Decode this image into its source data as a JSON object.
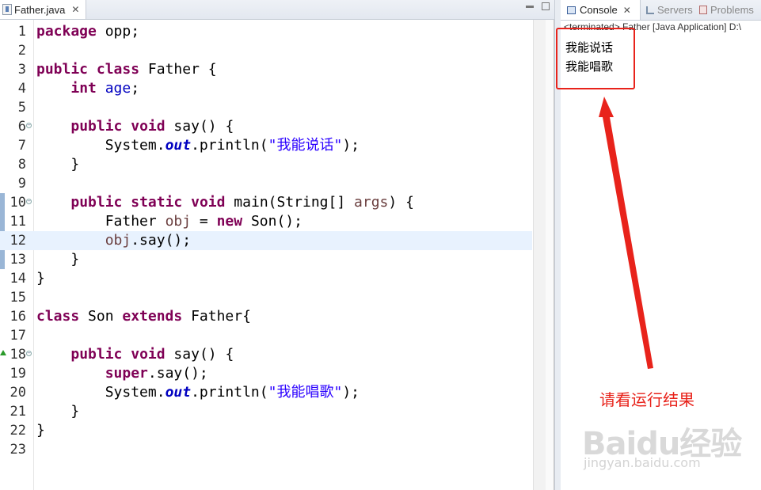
{
  "editor": {
    "tab_title": "Father.java",
    "tab_close": "✕",
    "code_lines": [
      {
        "n": "1",
        "tokens": [
          {
            "c": "kw",
            "t": "package"
          },
          {
            "c": "",
            "t": " opp;"
          }
        ]
      },
      {
        "n": "2",
        "tokens": []
      },
      {
        "n": "3",
        "tokens": [
          {
            "c": "kw",
            "t": "public"
          },
          {
            "c": "",
            "t": " "
          },
          {
            "c": "kw",
            "t": "class"
          },
          {
            "c": "",
            "t": " Father {"
          }
        ]
      },
      {
        "n": "4",
        "tokens": [
          {
            "c": "",
            "t": "    "
          },
          {
            "c": "kw",
            "t": "int"
          },
          {
            "c": "",
            "t": " "
          },
          {
            "c": "fld",
            "t": "age"
          },
          {
            "c": "",
            "t": ";"
          }
        ]
      },
      {
        "n": "5",
        "tokens": []
      },
      {
        "n": "6",
        "fold": true,
        "tokens": [
          {
            "c": "",
            "t": "    "
          },
          {
            "c": "kw",
            "t": "public"
          },
          {
            "c": "",
            "t": " "
          },
          {
            "c": "kw",
            "t": "void"
          },
          {
            "c": "",
            "t": " say() {"
          }
        ]
      },
      {
        "n": "7",
        "tokens": [
          {
            "c": "",
            "t": "        System."
          },
          {
            "c": "sfld",
            "t": "out"
          },
          {
            "c": "",
            "t": ".println("
          },
          {
            "c": "str",
            "t": "\"我能说话\""
          },
          {
            "c": "",
            "t": ");"
          }
        ]
      },
      {
        "n": "8",
        "tokens": [
          {
            "c": "",
            "t": "    }"
          }
        ]
      },
      {
        "n": "9",
        "tokens": []
      },
      {
        "n": "10",
        "fold": true,
        "tokens": [
          {
            "c": "",
            "t": "    "
          },
          {
            "c": "kw",
            "t": "public"
          },
          {
            "c": "",
            "t": " "
          },
          {
            "c": "kw",
            "t": "static"
          },
          {
            "c": "",
            "t": " "
          },
          {
            "c": "kw",
            "t": "void"
          },
          {
            "c": "",
            "t": " main(String[] "
          },
          {
            "c": "var",
            "t": "args"
          },
          {
            "c": "",
            "t": ") {"
          }
        ]
      },
      {
        "n": "11",
        "tokens": [
          {
            "c": "",
            "t": "        Father "
          },
          {
            "c": "var",
            "t": "obj"
          },
          {
            "c": "",
            "t": " = "
          },
          {
            "c": "kw",
            "t": "new"
          },
          {
            "c": "",
            "t": " Son();"
          }
        ]
      },
      {
        "n": "12",
        "current": true,
        "tokens": [
          {
            "c": "",
            "t": "        "
          },
          {
            "c": "var",
            "t": "obj"
          },
          {
            "c": "",
            "t": ".say();"
          }
        ]
      },
      {
        "n": "13",
        "tokens": [
          {
            "c": "",
            "t": "    }"
          }
        ]
      },
      {
        "n": "14",
        "tokens": [
          {
            "c": "",
            "t": "}"
          }
        ]
      },
      {
        "n": "15",
        "tokens": []
      },
      {
        "n": "16",
        "tokens": [
          {
            "c": "kw",
            "t": "class"
          },
          {
            "c": "",
            "t": " Son "
          },
          {
            "c": "kw",
            "t": "extends"
          },
          {
            "c": "",
            "t": " Father{"
          }
        ]
      },
      {
        "n": "17",
        "tokens": []
      },
      {
        "n": "18",
        "fold": true,
        "override": true,
        "tokens": [
          {
            "c": "",
            "t": "    "
          },
          {
            "c": "kw",
            "t": "public"
          },
          {
            "c": "",
            "t": " "
          },
          {
            "c": "kw",
            "t": "void"
          },
          {
            "c": "",
            "t": " say() {"
          }
        ]
      },
      {
        "n": "19",
        "tokens": [
          {
            "c": "",
            "t": "        "
          },
          {
            "c": "kw",
            "t": "super"
          },
          {
            "c": "",
            "t": ".say();"
          }
        ]
      },
      {
        "n": "20",
        "tokens": [
          {
            "c": "",
            "t": "        System."
          },
          {
            "c": "sfld",
            "t": "out"
          },
          {
            "c": "",
            "t": ".println("
          },
          {
            "c": "str",
            "t": "\"我能唱歌\""
          },
          {
            "c": "",
            "t": ");"
          }
        ]
      },
      {
        "n": "21",
        "tokens": [
          {
            "c": "",
            "t": "    }"
          }
        ]
      },
      {
        "n": "22",
        "tokens": [
          {
            "c": "",
            "t": "}"
          }
        ]
      },
      {
        "n": "23",
        "tokens": []
      }
    ]
  },
  "console": {
    "tabs": [
      {
        "label": "Console",
        "icon": "console-icon",
        "active": true
      },
      {
        "label": "Servers",
        "icon": "servers-icon",
        "active": false
      },
      {
        "label": "Problems",
        "icon": "problems-icon",
        "active": false
      }
    ],
    "close": "✕",
    "status": "<terminated> Father [Java Application] D:\\",
    "output": [
      "我能说话",
      "我能唱歌"
    ]
  },
  "annotation": {
    "hint": "请看运行结果",
    "color": "#e8231b"
  },
  "watermark": {
    "brand": "Baidu经验",
    "url": "jingyan.baidu.com"
  }
}
